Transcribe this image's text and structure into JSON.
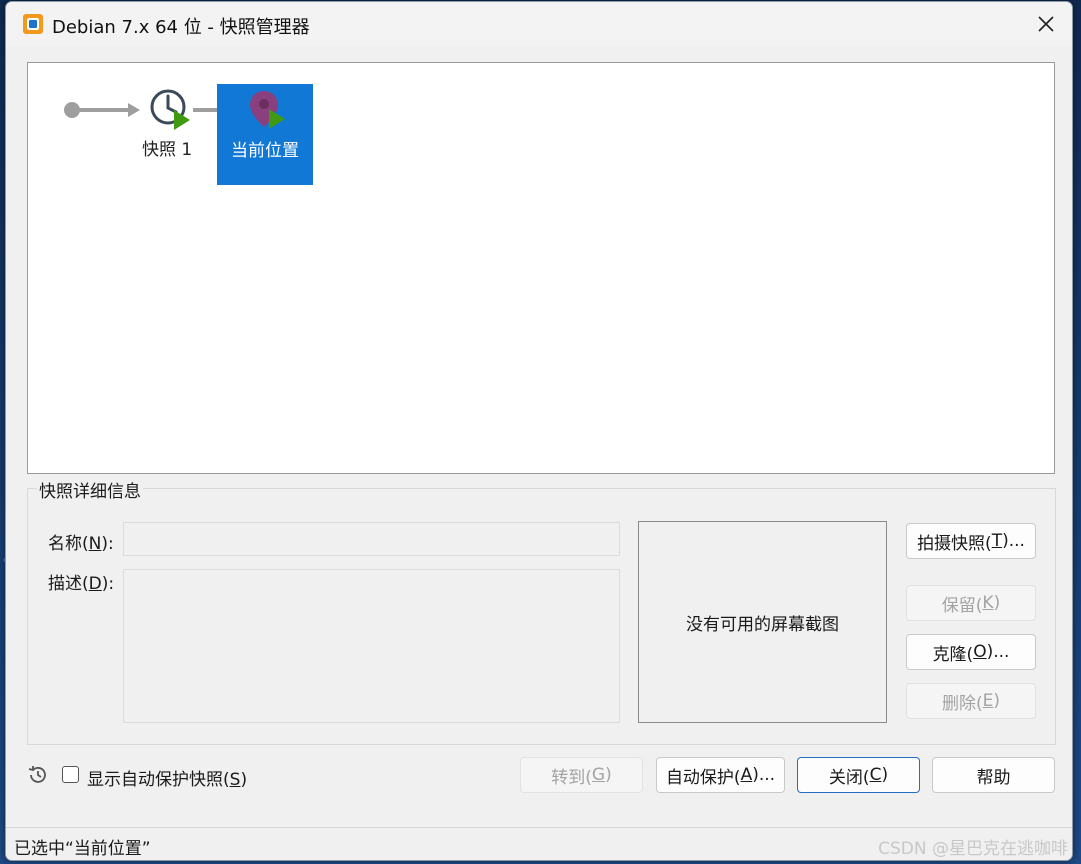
{
  "window": {
    "title": "Debian 7.x 64 位 - 快照管理器"
  },
  "tree": {
    "snapshot_label": "快照 1",
    "current_label": "当前位置"
  },
  "details": {
    "legend": "快照详细信息",
    "name_label_prefix": "名称(",
    "name_label_key": "N",
    "name_label_suffix": "):",
    "name_value": "",
    "desc_label_prefix": "描述(",
    "desc_label_key": "D",
    "desc_label_suffix": "):",
    "desc_value": "",
    "no_screenshot": "没有可用的屏幕截图"
  },
  "side_buttons": {
    "take_snapshot": {
      "prefix": "拍摄快照(",
      "key": "T",
      "suffix": ")..."
    },
    "keep": {
      "prefix": "保留(",
      "key": "K",
      "suffix": ")"
    },
    "clone": {
      "prefix": "克隆(",
      "key": "O",
      "suffix": ")..."
    },
    "delete": {
      "prefix": "删除(",
      "key": "E",
      "suffix": ")"
    }
  },
  "bottom": {
    "show_autoprotect_prefix": "显示自动保护快照(",
    "show_autoprotect_key": "S",
    "show_autoprotect_suffix": ")",
    "goto": {
      "prefix": "转到(",
      "key": "G",
      "suffix": ")"
    },
    "autoprotect": {
      "prefix": "自动保护(",
      "key": "A",
      "suffix": ")..."
    },
    "close": {
      "prefix": "关闭(",
      "key": "C",
      "suffix": ")"
    },
    "help": "帮助"
  },
  "status": {
    "text": "已选中“当前位置”",
    "watermark": "CSDN @星巴克在逃咖啡"
  },
  "colors": {
    "selection": "#1178d6",
    "play_green": "#3f9a12",
    "pin_purple": "#8a3f7e",
    "arrow_gray": "#9e9e9e",
    "clock_dark": "#3a4a5a"
  },
  "icons": {
    "app": "vmware-app-icon",
    "close": "close-icon",
    "snapshot": "snapshot-clock-icon",
    "current": "current-location-icon",
    "history": "history-icon"
  }
}
